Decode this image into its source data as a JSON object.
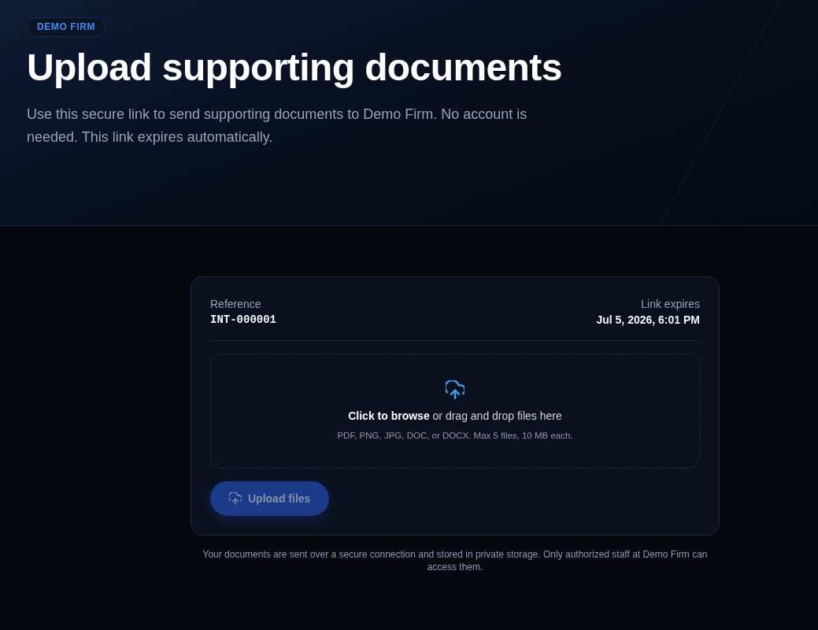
{
  "header": {
    "badge": "DEMO FIRM",
    "title": "Upload supporting documents",
    "subtitle": "Use this secure link to send supporting documents to Demo Firm. No account is needed. This link expires automatically."
  },
  "card": {
    "reference": {
      "label": "Reference",
      "value": "INT-000001"
    },
    "expires": {
      "label": "Link expires",
      "value": "Jul 5, 2026, 6:01 PM"
    },
    "dropzone": {
      "prompt": "**Click to browse** or drag and drop files here",
      "hint": "PDF, PNG, JPG, DOC, or DOCX. Max 5 files, 10 MB each."
    },
    "upload_button": {
      "label": "Upload files",
      "disabled": true
    }
  },
  "footer_note": "Your documents are sent over a secure connection and stored in private storage. Only authorized staff at Demo Firm can access them."
}
